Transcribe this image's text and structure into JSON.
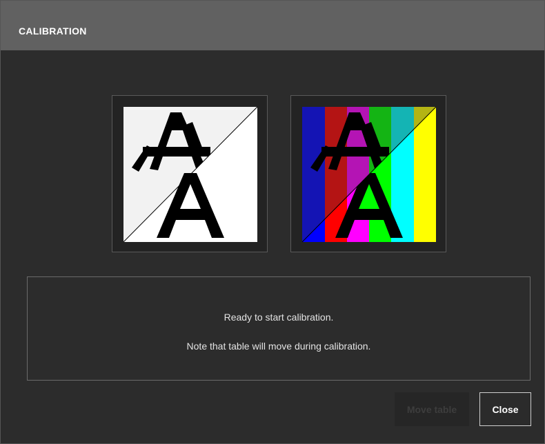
{
  "dialog": {
    "title": "CALIBRATION"
  },
  "preview": {
    "left": {
      "icon": "calibration-pattern-grayscale-icon",
      "glyph": "A"
    },
    "right": {
      "icon": "calibration-pattern-colorbars-icon",
      "glyph": "A"
    }
  },
  "message": {
    "line1": "Ready to start calibration.",
    "line2": "Note that table will move during calibration."
  },
  "buttons": {
    "move_table": {
      "label": "Move table",
      "enabled": false
    },
    "close": {
      "label": "Close",
      "enabled": true
    }
  },
  "colors": {
    "titlebar": "#616161",
    "background": "#2c2c2c",
    "bars_top": [
      "#1414b4",
      "#b41414",
      "#b414b4",
      "#14b414",
      "#14b4b4",
      "#b4b414"
    ],
    "bars_bottom": [
      "#0000ff",
      "#ff0000",
      "#ff00ff",
      "#00ff00",
      "#00ffff",
      "#ffff00"
    ]
  }
}
